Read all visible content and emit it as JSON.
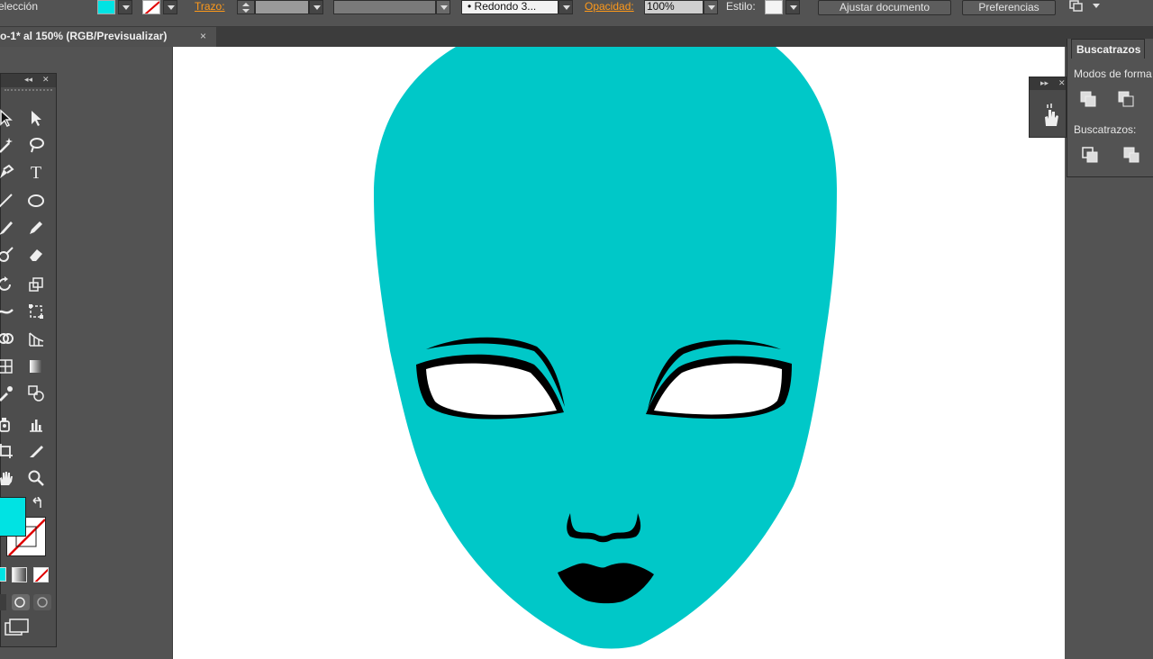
{
  "controlbar": {
    "selection_label": "elección",
    "stroke_label": "Trazo:",
    "brush_value": "• Redondo 3...",
    "opacity_label": "Opacidad:",
    "opacity_value": "100%",
    "style_label": "Estilo:",
    "fit_button": "Ajustar documento",
    "prefs_button": "Preferencias",
    "fill_color": "#00e3e3"
  },
  "tabbar": {
    "doc_title": "o-1* al 150% (RGB/Previsualizar)",
    "close_glyph": "×"
  },
  "tools_panel": {
    "header_glyph": "◂◂",
    "close_glyph": "✕",
    "tools": [
      {
        "name": "selection-tool-icon"
      },
      {
        "name": "direct-selection-tool-icon"
      },
      {
        "name": "magic-wand-tool-icon"
      },
      {
        "name": "lasso-tool-icon"
      },
      {
        "name": "pen-tool-icon"
      },
      {
        "name": "type-tool-icon",
        "glyph": "T"
      },
      {
        "name": "line-tool-icon"
      },
      {
        "name": "ellipse-tool-icon"
      },
      {
        "name": "paintbrush-tool-icon"
      },
      {
        "name": "pencil-tool-icon"
      },
      {
        "name": "blob-brush-tool-icon"
      },
      {
        "name": "eraser-tool-icon"
      },
      {
        "name": "rotate-tool-icon"
      },
      {
        "name": "scale-tool-icon"
      },
      {
        "name": "width-tool-icon"
      },
      {
        "name": "free-transform-tool-icon"
      },
      {
        "name": "shape-builder-tool-icon"
      },
      {
        "name": "perspective-grid-tool-icon"
      },
      {
        "name": "mesh-tool-icon"
      },
      {
        "name": "gradient-tool-icon"
      },
      {
        "name": "eyedropper-tool-icon"
      },
      {
        "name": "blend-tool-icon"
      },
      {
        "name": "symbol-sprayer-tool-icon"
      },
      {
        "name": "column-graph-tool-icon"
      },
      {
        "name": "artboard-tool-icon"
      },
      {
        "name": "slice-tool-icon"
      },
      {
        "name": "hand-tool-icon"
      },
      {
        "name": "zoom-tool-icon"
      }
    ]
  },
  "minidock": {
    "header_glyph": "▸▸",
    "close_glyph": "✕"
  },
  "pathfinder": {
    "tab_label": "Buscatrazos",
    "shape_modes_label": "Modos de forma",
    "pathfinders_label": "Buscatrazos:"
  },
  "artwork": {
    "face_color": "#00c8c8",
    "feature_color": "#000000"
  }
}
